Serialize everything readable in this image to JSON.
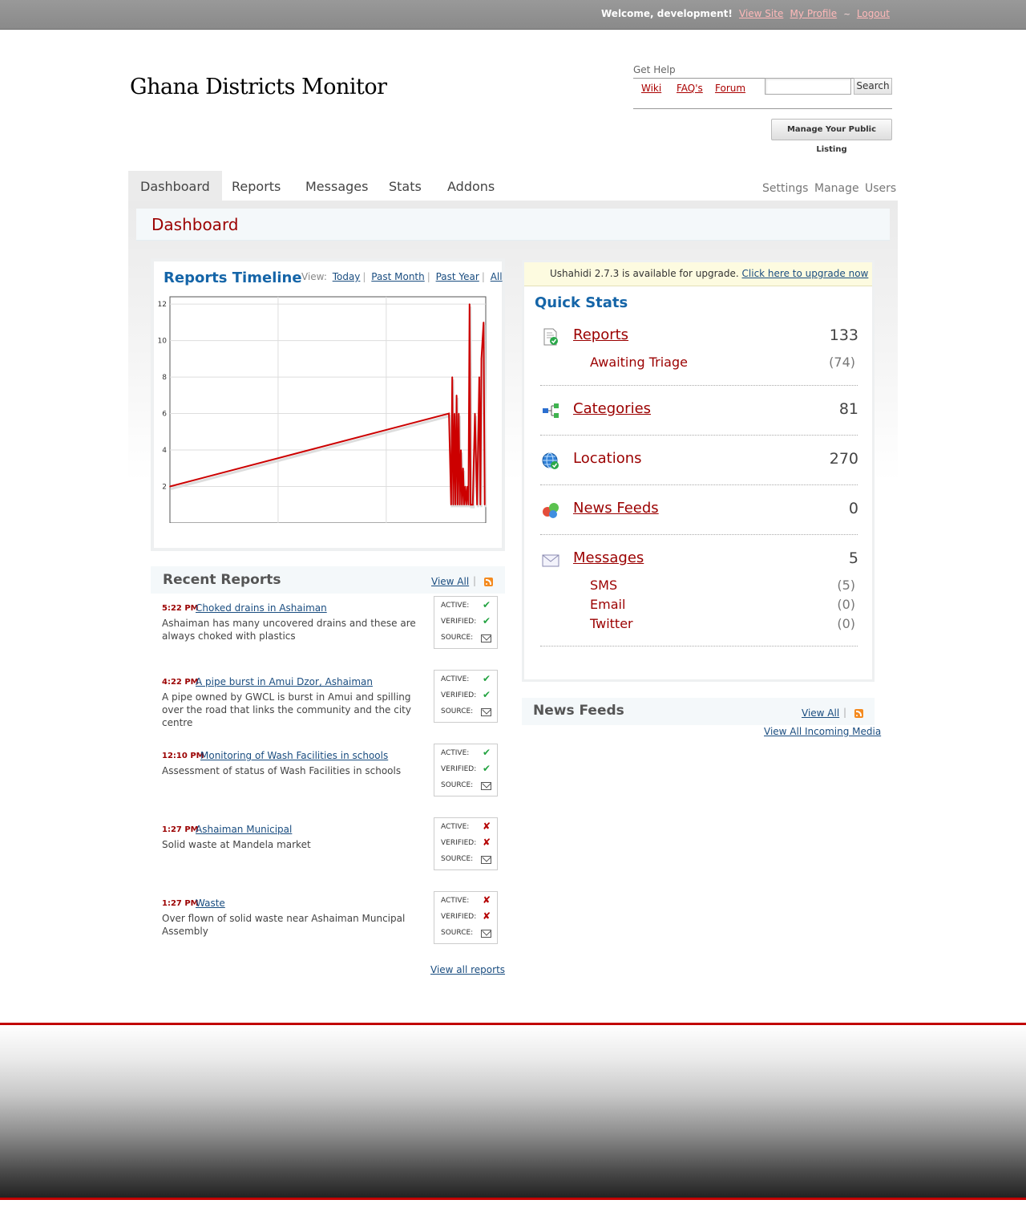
{
  "topbar": {
    "welcome": "Welcome, development!",
    "view_site": "View Site",
    "my_profile": "My Profile",
    "separator": "~",
    "logout": "Logout"
  },
  "site": {
    "title": "Ghana Districts Monitor"
  },
  "help": {
    "label": "Get Help",
    "links": [
      "Wiki",
      "FAQ's",
      "Forum"
    ],
    "search_placeholder": "",
    "search_button": "Search",
    "manage_listing": "Manage Your Public Listing"
  },
  "nav": {
    "tabs": [
      "Dashboard",
      "Reports",
      "Messages",
      "Stats",
      "Addons"
    ],
    "active": "Dashboard",
    "secondary": [
      "Settings",
      "Manage",
      "Users"
    ]
  },
  "page": {
    "title": "Dashboard"
  },
  "timeline": {
    "title": "Reports Timeline",
    "view_label": "View:",
    "views": [
      "Today",
      "Past Month",
      "Past Year",
      "All"
    ]
  },
  "chart_data": {
    "type": "line",
    "title": "Reports Timeline",
    "xlabel": "",
    "ylabel": "",
    "x_ticks": [
      "2000",
      "2005",
      "2010"
    ],
    "y_ticks": [
      2,
      4,
      6,
      8,
      10,
      12
    ],
    "xlim": [
      2000,
      2014.6
    ],
    "ylim": [
      0,
      12.4
    ],
    "grid": true,
    "series": [
      {
        "color": "#cc0000",
        "x": [
          2000.0,
          2012.9,
          2013.0,
          2013.05,
          2013.1,
          2013.15,
          2013.2,
          2013.25,
          2013.3,
          2013.35,
          2013.4,
          2013.45,
          2013.5,
          2013.55,
          2013.6,
          2013.65,
          2013.7,
          2013.75,
          2013.8,
          2013.85,
          2013.9,
          2013.95,
          2014.0,
          2014.1,
          2014.2,
          2014.3,
          2014.35,
          2014.4,
          2014.5,
          2014.55
        ],
        "y": [
          2,
          6,
          1,
          8,
          1,
          6,
          1,
          7,
          1,
          6,
          1,
          4,
          1,
          3,
          1,
          2,
          1,
          2,
          1,
          12,
          1,
          1,
          1,
          6,
          1,
          8,
          1,
          9,
          11,
          1
        ]
      }
    ]
  },
  "recent_reports": {
    "title": "Recent Reports",
    "view_all": "View All",
    "separator": "|",
    "status_labels": {
      "active": "ACTIVE:",
      "verified": "VERIFIED:",
      "source": "SOURCE:"
    },
    "items": [
      {
        "time": "5:22 PM",
        "title": "Choked drains in Ashaiman",
        "desc": "Ashaiman has many uncovered drains and these are always choked with plastics",
        "active": "✔",
        "verified": "✔"
      },
      {
        "time": "4:22 PM",
        "title": "A pipe burst in Amui Dzor, Ashaiman",
        "desc": "A pipe owned by GWCL is burst in Amui and spilling over the road that links the community and the city centre",
        "active": "✔",
        "verified": "✔"
      },
      {
        "time": "12:10 PM",
        "title": "Monitoring of Wash Facilities in schools",
        "desc": "Assessment of status of Wash Facilities in schools",
        "active": "✔",
        "verified": "✔"
      },
      {
        "time": "1:27 PM",
        "title": "Ashaiman Municipal",
        "desc": "Solid waste at Mandela market",
        "active": "✘",
        "verified": "✘"
      },
      {
        "time": "1:27 PM",
        "title": "Waste",
        "desc": "Over flown of solid waste near Ashaiman Muncipal Assembly",
        "active": "✘",
        "verified": "✘"
      }
    ],
    "view_all_reports": "View all reports"
  },
  "upgrade": {
    "text": "Ushahidi 2.7.3 is available for upgrade.",
    "link": "Click here to upgrade now"
  },
  "quick_stats": {
    "title": "Quick Stats",
    "reports": {
      "label": "Reports",
      "value": "133",
      "sub_label": "Awaiting Triage",
      "sub_value": "(74)"
    },
    "categories": {
      "label": "Categories",
      "value": "81"
    },
    "locations": {
      "label": "Locations",
      "value": "270"
    },
    "news_feeds": {
      "label": "News Feeds",
      "value": "0"
    },
    "messages": {
      "label": "Messages",
      "value": "5",
      "subs": [
        {
          "label": "SMS",
          "value": "(5)"
        },
        {
          "label": "Email",
          "value": "(0)"
        },
        {
          "label": "Twitter",
          "value": "(0)"
        }
      ]
    }
  },
  "news_feeds": {
    "title": "News Feeds",
    "view_all": "View All",
    "separator": "|",
    "view_all_incoming": "View All Incoming Media"
  }
}
